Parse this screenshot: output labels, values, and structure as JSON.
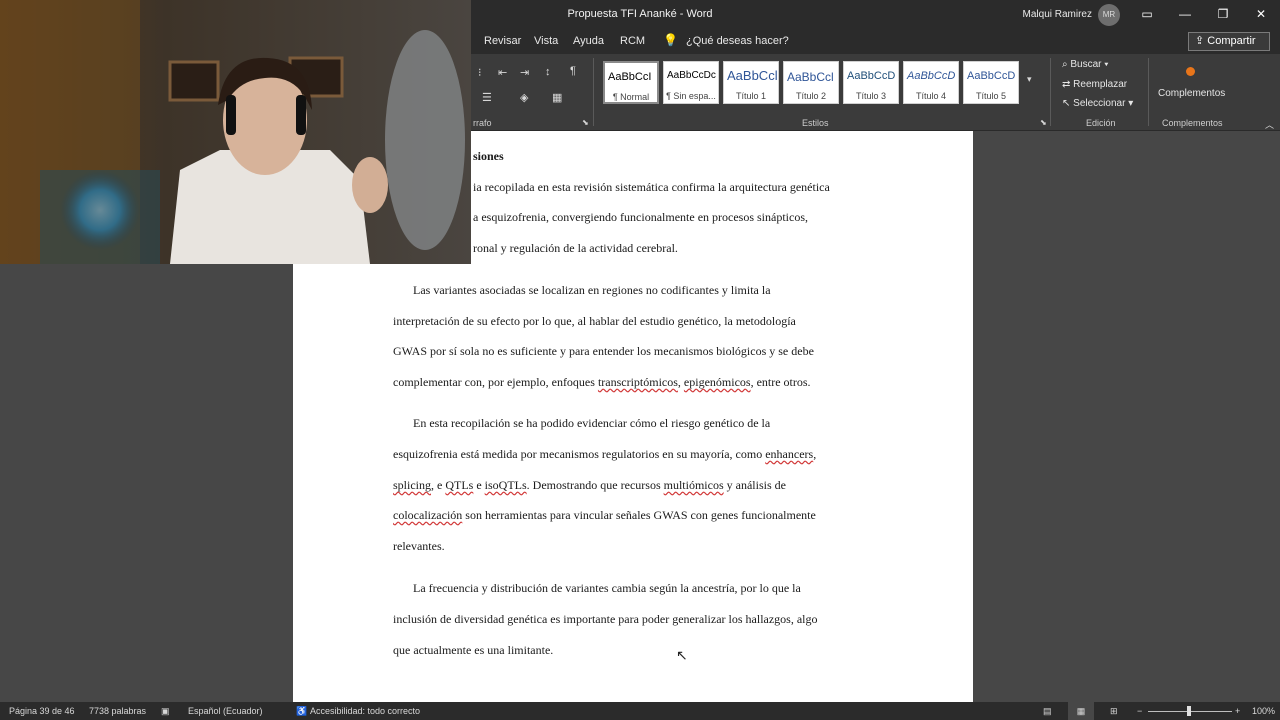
{
  "window": {
    "title": "Propuesta TFI Ananké  -  Word",
    "user_name": "Malqui Ramirez",
    "user_initials": "MR"
  },
  "tabs": [
    "Revisar",
    "Vista",
    "Ayuda",
    "RCM"
  ],
  "tell_me": "¿Qué deseas hacer?",
  "share_label": "Compartir",
  "groups": {
    "paragraph": "rrafo",
    "styles": "Estilos",
    "editing": "Edición",
    "addins": "Complementos"
  },
  "styles": [
    {
      "sample": "AaBbCcI",
      "name": "¶ Normal"
    },
    {
      "sample": "AaBbCcDc",
      "name": "¶ Sin espa..."
    },
    {
      "sample": "AaBbCcl",
      "name": "Título 1"
    },
    {
      "sample": "AaBbCcl",
      "name": "Título 2"
    },
    {
      "sample": "AaBbCcD",
      "name": "Título 3"
    },
    {
      "sample": "AaBbCcD",
      "name": "Título 4"
    },
    {
      "sample": "AaBbCcD",
      "name": "Título 5"
    }
  ],
  "editing": {
    "find": "Buscar",
    "replace": "Reemplazar",
    "select": "Seleccionar"
  },
  "addins_label": "Complementos",
  "document": {
    "heading": "siones",
    "p1": [
      "ia recopilada en esta revisión sistemática confirma la arquitectura genética",
      "a esquizofrenia, convergiendo funcionalmente en procesos sinápticos,",
      "ronal y regulación de la actividad cerebral."
    ],
    "p2": [
      "Las variantes asociadas se localizan en regiones no codificantes y limita la",
      "interpretación de su efecto por lo que, al hablar del estudio genético, la metodología",
      "GWAS por sí sola no es suficiente y para entender los mecanismos biológicos y se debe",
      "complementar con, por ejemplo, enfoques ",
      "transcriptómicos",
      ", ",
      "epigenómicos",
      ", entre otros."
    ],
    "p3": [
      "En esta recopilación se ha podido evidenciar cómo el riesgo genético de la",
      "esquizofrenia está medida por mecanismos regulatorios en su mayoría, como ",
      "enhancers",
      ",",
      "splicing",
      ", e ",
      "QTLs",
      " e ",
      "isoQTLs",
      ". Demostrando que recursos ",
      "multiómicos",
      " y análisis de",
      "colocalización",
      " son herramientas para vincular señales GWAS con genes funcionalmente",
      "relevantes."
    ],
    "p4": [
      "La frecuencia y distribución de variantes cambia según la ancestría, por lo que la",
      "inclusión de diversidad genética es importante para poder generalizar los hallazgos, algo",
      "que actualmente es una limitante."
    ]
  },
  "status": {
    "page": "Página 39 de 46",
    "words": "7738 palabras",
    "language": "Español (Ecuador)",
    "accessibility": "Accesibilidad: todo correcto",
    "zoom": "100%"
  }
}
